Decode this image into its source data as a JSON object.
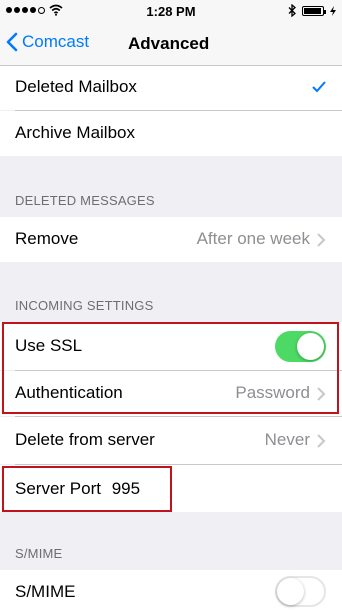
{
  "status_bar": {
    "time": "1:28 PM"
  },
  "nav": {
    "back_label": "Comcast",
    "title": "Advanced"
  },
  "mailbox_rows": [
    {
      "label": "Deleted Mailbox",
      "checked": true
    },
    {
      "label": "Archive Mailbox"
    }
  ],
  "deleted_messages": {
    "header": "DELETED MESSAGES",
    "remove_label": "Remove",
    "remove_value": "After one week"
  },
  "incoming_settings": {
    "header": "INCOMING SETTINGS",
    "use_ssl_label": "Use SSL",
    "use_ssl_on": true,
    "authentication_label": "Authentication",
    "authentication_value": "Password",
    "delete_from_server_label": "Delete from server",
    "delete_from_server_value": "Never",
    "server_port_label": "Server Port",
    "server_port_value": "995"
  },
  "smime": {
    "header": "S/MIME",
    "label": "S/MIME",
    "on": false
  },
  "colors": {
    "accent": "#007aff",
    "toggle_on": "#4cd964",
    "highlight_border": "#c1121f"
  }
}
